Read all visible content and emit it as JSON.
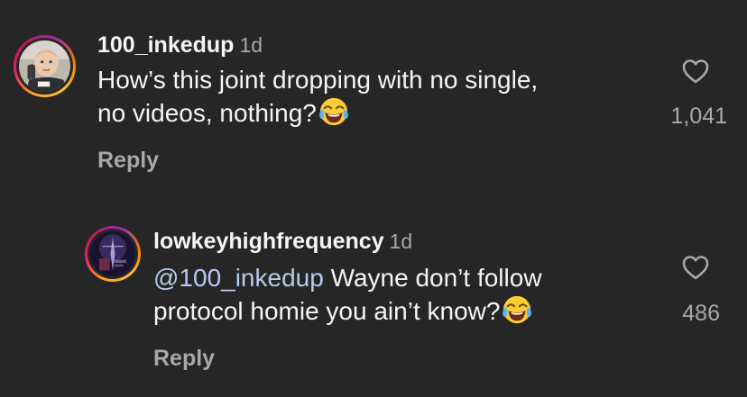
{
  "comments": [
    {
      "username": "100_inkedup",
      "time": "1d",
      "line1": "How’s this joint dropping with no single,",
      "line2": "no videos, nothing?",
      "likes": "1,041",
      "reply_label": "Reply",
      "emoji": "face-with-tears-of-joy"
    },
    {
      "username": "lowkeyhighfrequency",
      "time": "1d",
      "mention": "@100_inkedup",
      "line1_rest": " Wayne don’t follow",
      "line2": "protocol homie you ain’t know?",
      "likes": "486",
      "reply_label": "Reply",
      "emoji": "face-with-tears-of-joy"
    }
  ],
  "icons": {
    "like": "heart-outline-icon",
    "emoji": "face-with-tears-of-joy-icon"
  },
  "colors": {
    "background": "#262626",
    "text_primary": "#f5f5f5",
    "text_secondary": "#a8a8a8",
    "mention": "#b8c9f0"
  }
}
